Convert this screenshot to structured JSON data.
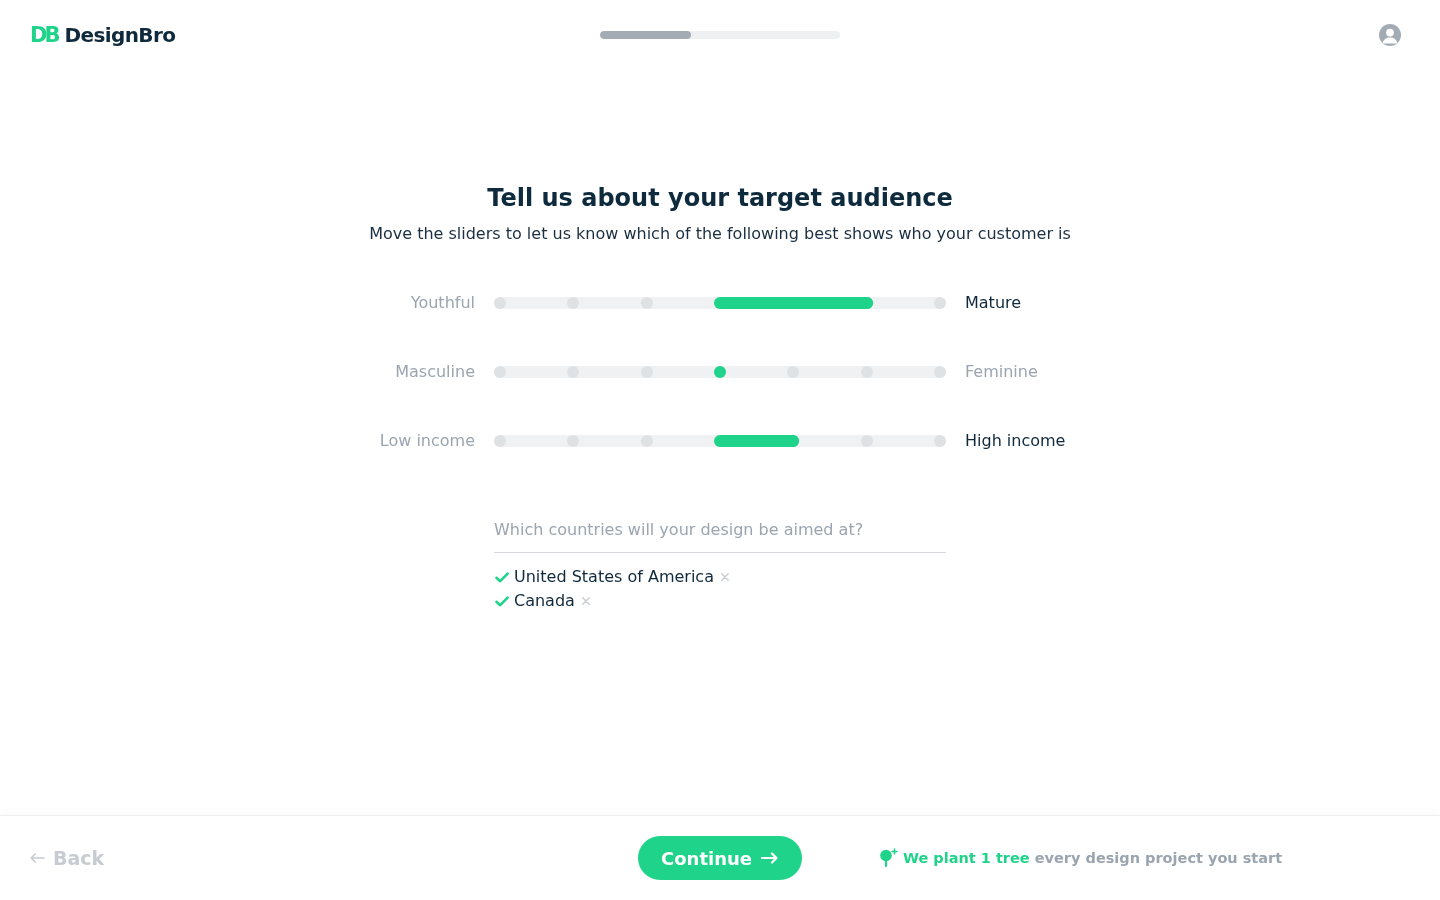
{
  "header": {
    "logo": {
      "mark": "DB",
      "name": "DesignBro"
    },
    "progress": {
      "level": 0.38
    }
  },
  "title": "Tell us about your target audience",
  "subtitle": "Move the sliders to let us know which of the following best shows who your customer is",
  "sliders": [
    {
      "left_label": "Youthful",
      "right_label": "Mature",
      "level": 0.8333
    },
    {
      "left_label": "Masculine",
      "right_label": "Feminine",
      "level": 0.5
    },
    {
      "left_label": "Low income",
      "right_label": "High income",
      "level": 0.6667
    }
  ],
  "countries": {
    "placeholder": "Which countries will your design be aimed at?",
    "tags": [
      {
        "name": "United States of America"
      },
      {
        "name": "Canada"
      }
    ]
  },
  "footer": {
    "back": "Back",
    "continue": "Continue",
    "tree_note": {
      "highlight": "We plant 1 tree",
      "text": "every design project you start"
    }
  }
}
